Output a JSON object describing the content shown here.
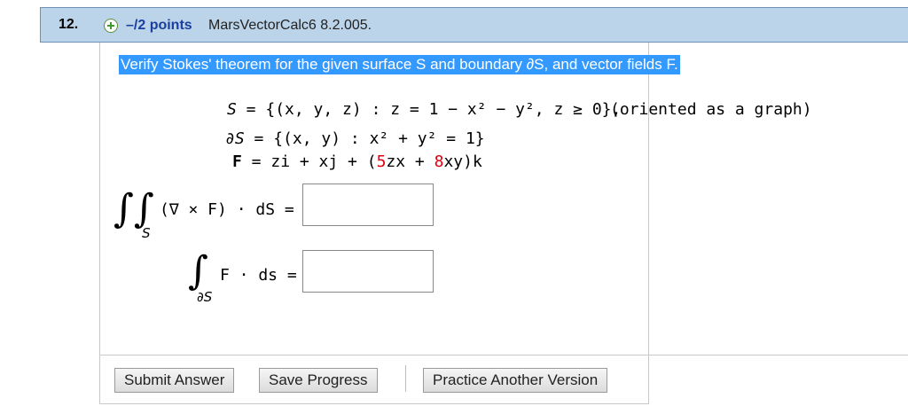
{
  "question": {
    "number": "12.",
    "points": "–/2 points",
    "source": "MarsVectorCalc6 8.2.005.",
    "prompt": "Verify Stokes' theorem for the given surface S and boundary ∂S, and vector fields F."
  },
  "equations": {
    "s_lhs": "S",
    "s_rhs": "{(x, y, z) : z = 1 − x² − y², z ≥ 0},",
    "s_note": "(oriented as a graph)",
    "ds_lhs": "∂S",
    "ds_rhs": "{(x, y) : x² + y² = 1}",
    "f_lhs": "F",
    "f_rhs_1": "zi + xj + (",
    "f_coef_1": "5",
    "f_rhs_2": "zx + ",
    "f_coef_2": "8",
    "f_rhs_3": "xy)k"
  },
  "integrals": {
    "surface_sub": "S",
    "surface_expr": "(∇ × F) · dS =",
    "line_sub": "∂S",
    "line_expr": "F · ds ="
  },
  "answers": {
    "surface_value": "",
    "line_value": ""
  },
  "buttons": {
    "submit": "Submit Answer",
    "save": "Save Progress",
    "practice": "Practice Another Version"
  }
}
